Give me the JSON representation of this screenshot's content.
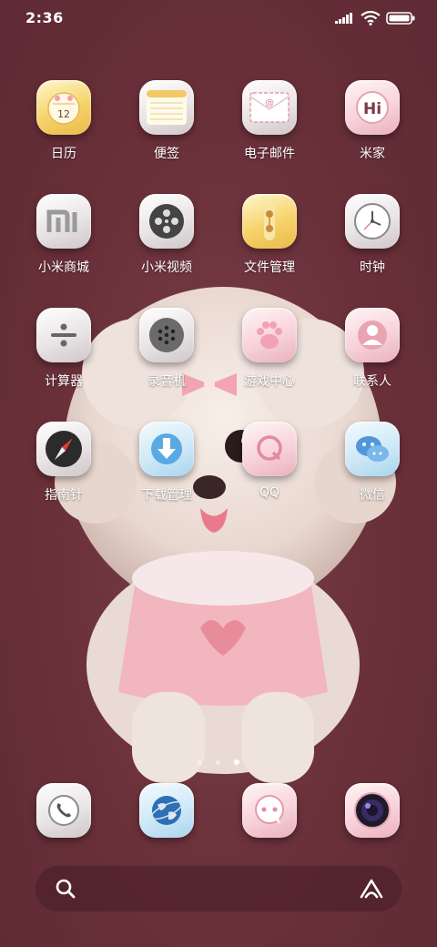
{
  "status_bar": {
    "time": "2:36"
  },
  "apps": [
    {
      "label": "日历"
    },
    {
      "label": "便签"
    },
    {
      "label": "电子邮件"
    },
    {
      "label": "米家"
    },
    {
      "label": "小米商城"
    },
    {
      "label": "小米视频"
    },
    {
      "label": "文件管理"
    },
    {
      "label": "时钟"
    },
    {
      "label": "计算器"
    },
    {
      "label": "录音机"
    },
    {
      "label": "游戏中心"
    },
    {
      "label": "联系人"
    },
    {
      "label": "指南针"
    },
    {
      "label": "下载管理"
    },
    {
      "label": "QQ"
    },
    {
      "label": "微信"
    }
  ],
  "calendar_day": "12",
  "page_indicator": {
    "pages": 3,
    "current": 3
  },
  "dock": [
    "phone",
    "browser",
    "messages",
    "camera"
  ]
}
